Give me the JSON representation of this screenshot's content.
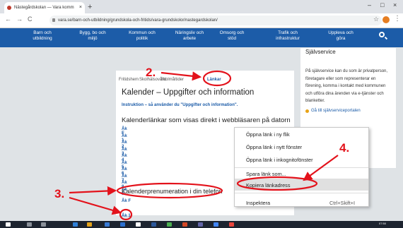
{
  "browser": {
    "tab_title": "Nästegårdskolan — Vara komm",
    "tab_close": "×",
    "new_tab": "+",
    "url": "vara.se/barn-och-utbildning/grundskola-och-fritids/vara-grundskolor/nastegardskolan/",
    "win_min": "–",
    "win_max": "□",
    "win_close": "×",
    "back": "←",
    "forward": "→",
    "reload": "C",
    "star": "☆",
    "menu": "⋮"
  },
  "site_nav": [
    {
      "label": "Barn och utbildning"
    },
    {
      "label": "Bygg, bo och miljö"
    },
    {
      "label": "Kommun och politik"
    },
    {
      "label": "Näringsliv och arbete"
    },
    {
      "label": "Omsorg och stöd"
    },
    {
      "label": "Trafik och infrastruktur"
    },
    {
      "label": "Uppleva och göra"
    }
  ],
  "breadcrumb": {
    "item1": "Fritidshem",
    "item2": "Skolhälsovård",
    "item3": "Skolmåltider",
    "active": "Länkar"
  },
  "main": {
    "heading": "Kalender – Uppgifter och information",
    "instruction": "Instruktion – så använder du \"Uppgifter och information\".",
    "section1": "Kalenderlänkar som visas direkt i webbläsaren på datorn",
    "grades": [
      "Åk F",
      "Åk 1",
      "Åk 2",
      "Åk 3",
      "Åk 4",
      "Åk 5",
      "Åk 6",
      "Åk 7",
      "Åk 8",
      "Åk 9"
    ],
    "section2": "Kalenderprenumeration i din telefon",
    "grade_f2": "Åk F",
    "grade_1b": "Åk 1"
  },
  "sidebar": {
    "title": "Självservice",
    "text": "På självservice kan du som är privatperson, företagare eller som representerar en förening, komma i kontakt med kommunen och utföra dina ärenden via e-tjänster och blanketter.",
    "link": "Gå till självserviceportalen"
  },
  "context_menu": {
    "items": [
      {
        "label": "Öppna länk i ny flik"
      },
      {
        "label": "Öppna länk i nytt fönster"
      },
      {
        "label": "Öppna länk i inkognitofönster"
      },
      {
        "label": "Spara länk som..."
      },
      {
        "label": "Kopiera länkadress"
      },
      {
        "label": "Inspektera"
      }
    ],
    "inspect_shortcut": "Ctrl+Skift+I"
  },
  "annotations": {
    "n2": "2.",
    "n3": "3.",
    "n4": "4."
  },
  "taskbar": {
    "clock": "07:50"
  },
  "colors": {
    "accent": "#1c5ca8",
    "annotation": "#e3121b",
    "taskbar": "#1d2430"
  }
}
